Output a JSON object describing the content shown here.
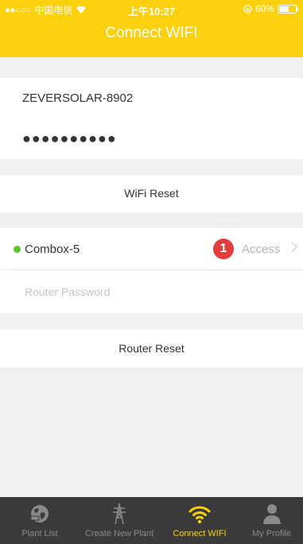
{
  "status_bar": {
    "carrier": "中国电信",
    "signal_dots": "●●○○○",
    "time": "上午10:27",
    "battery": "60%",
    "battery_level": 0.6
  },
  "nav": {
    "title": "Connect WIFI"
  },
  "wifi": {
    "ssid": "ZEVERSOLAR-8902",
    "password_masked": "●●●●●●●●●●",
    "reset_label": "WiFi Reset"
  },
  "router": {
    "network_name": "Combox-5",
    "badge_count": "1",
    "access_label": "Access",
    "password_placeholder": "Router Password",
    "reset_label": "Router Reset"
  },
  "tabs": [
    {
      "label": "Plant List",
      "icon": "globe-icon"
    },
    {
      "label": "Create New Plant",
      "icon": "power-tower-icon"
    },
    {
      "label": "Connect WIFI",
      "icon": "wifi-icon",
      "active": true
    },
    {
      "label": "My Profile",
      "icon": "person-icon"
    }
  ],
  "colors": {
    "accent": "#fbd10e",
    "status_online": "#5ec22d",
    "badge": "#e23c3c",
    "tabbar_bg": "#3b3b3b"
  }
}
